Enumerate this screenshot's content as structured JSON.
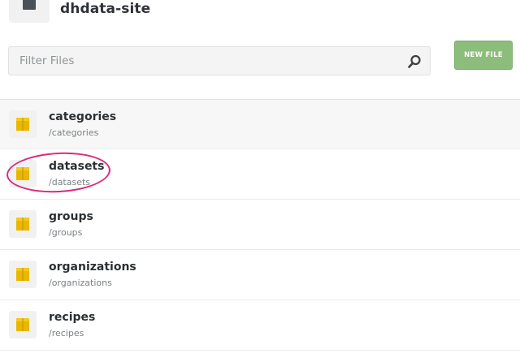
{
  "repo": {
    "title": "dhdata-site",
    "icon": "repository-icon"
  },
  "filter": {
    "placeholder": "Filter Files",
    "value": "",
    "icon": "search-icon"
  },
  "toolbar": {
    "new_file_label": "NEW FILE"
  },
  "colors": {
    "accent": "#8cbd7a",
    "folder": "#e9b600",
    "annotation": "#dc2a7a"
  },
  "files": [
    {
      "name": "categories",
      "path": "/categories",
      "icon": "folder-icon"
    },
    {
      "name": "datasets",
      "path": "/datasets",
      "icon": "folder-icon"
    },
    {
      "name": "groups",
      "path": "/groups",
      "icon": "folder-icon"
    },
    {
      "name": "organizations",
      "path": "/organizations",
      "icon": "folder-icon"
    },
    {
      "name": "recipes",
      "path": "/recipes",
      "icon": "folder-icon"
    }
  ]
}
